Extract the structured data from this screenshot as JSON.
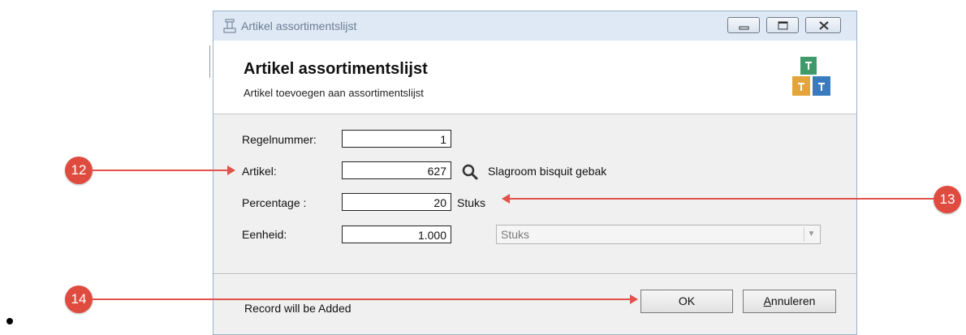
{
  "window": {
    "title": "Artikel assortimentslijst",
    "header_title": "Artikel assortimentslijst",
    "header_subtitle": "Artikel toevoegen aan assortimentslijst"
  },
  "form": {
    "regelnummer_label": "Regelnummer:",
    "regelnummer_value": "1",
    "artikel_label": "Artikel:",
    "artikel_value": "627",
    "artikel_description": "Slagroom bisquit gebak",
    "percentage_label": "Percentage :",
    "percentage_value": "20",
    "percentage_unit": "Stuks",
    "eenheid_label": "Eenheid:",
    "eenheid_value": "1.000",
    "eenheid_select": "Stuks"
  },
  "footer": {
    "status": "Record will be Added",
    "ok_label": "OK",
    "cancel_label_first": "A",
    "cancel_label_rest": "nnuleren"
  },
  "annotations": {
    "callout_12": "12",
    "callout_13": "13",
    "callout_14": "14"
  },
  "colors": {
    "accent_annotation": "#e04b3f",
    "titlebar": "#dfe9f5"
  }
}
